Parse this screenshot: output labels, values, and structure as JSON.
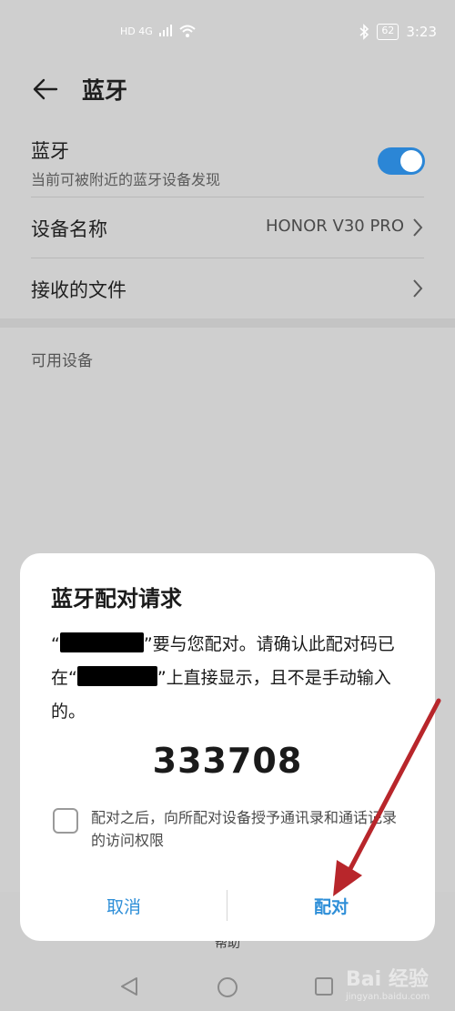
{
  "status": {
    "network": "HD 4G",
    "battery": "62",
    "time": "3:23"
  },
  "appbar": {
    "title": "蓝牙"
  },
  "settings": {
    "bluetooth": {
      "title": "蓝牙",
      "subtitle": "当前可被附近的蓝牙设备发现",
      "enabled": true
    },
    "device_name": {
      "label": "设备名称",
      "value": "HONOR V30 PRO"
    },
    "received_files": {
      "label": "接收的文件"
    },
    "available_devices_label": "可用设备"
  },
  "dialog": {
    "title": "蓝牙配对请求",
    "msg_part1": "“",
    "msg_part2": "”要与您配对。请确认此配对码已在“",
    "msg_part3": "”上直接显示，且不是手动输入的。",
    "code": "333708",
    "checkbox_label": "配对之后，向所配对设备授予通讯录和通话记录的访问权限",
    "cancel_label": "取消",
    "pair_label": "配对"
  },
  "bottom": {
    "help_label": "帮助"
  },
  "watermark": {
    "text": "Bai 经验",
    "sub": "jingyan.baidu.com"
  },
  "colors": {
    "accent": "#2b86d6",
    "button_text": "#2f8fd8",
    "annotation_arrow": "#b8262b"
  }
}
